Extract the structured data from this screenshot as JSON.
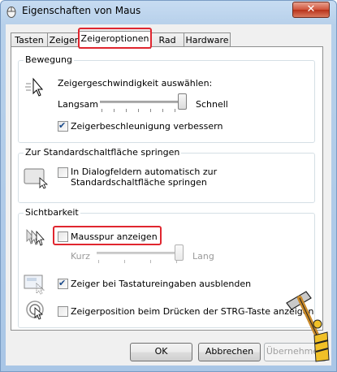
{
  "window": {
    "title": "Eigenschaften von Maus",
    "close_glyph": "✕"
  },
  "tabs": [
    {
      "label": "Tasten"
    },
    {
      "label": "Zeiger"
    },
    {
      "label": "Zeigeroptionen"
    },
    {
      "label": "Rad"
    },
    {
      "label": "Hardware"
    }
  ],
  "active_tab": "Zeigeroptionen",
  "motion": {
    "group_label": "Bewegung",
    "speed_label": "Zeigergeschwindigkeit auswählen:",
    "slow_label": "Langsam",
    "fast_label": "Schnell",
    "speed_value": 1.0,
    "precision_label": "Zeigerbeschleunigung verbessern",
    "precision_checked": true
  },
  "snapto": {
    "group_label": "Zur Standardschaltfläche springen",
    "label": "In Dialogfeldern automatisch zur Standardschaltfläche springen",
    "checked": false
  },
  "visibility": {
    "group_label": "Sichtbarkeit",
    "trails_label": "Mausspur anzeigen",
    "trails_checked": false,
    "short_label": "Kurz",
    "long_label": "Lang",
    "trails_value": 1.0,
    "hide_label": "Zeiger bei Tastatureingaben ausblenden",
    "hide_checked": true,
    "ctrl_label": "Zeigerposition beim Drücken der STRG-Taste anzeigen",
    "ctrl_checked": false
  },
  "buttons": {
    "ok": "OK",
    "cancel": "Abbrechen",
    "apply": "Übernehmen"
  },
  "colors": {
    "highlight": "#e0262f",
    "check": "#1a4a8a"
  }
}
